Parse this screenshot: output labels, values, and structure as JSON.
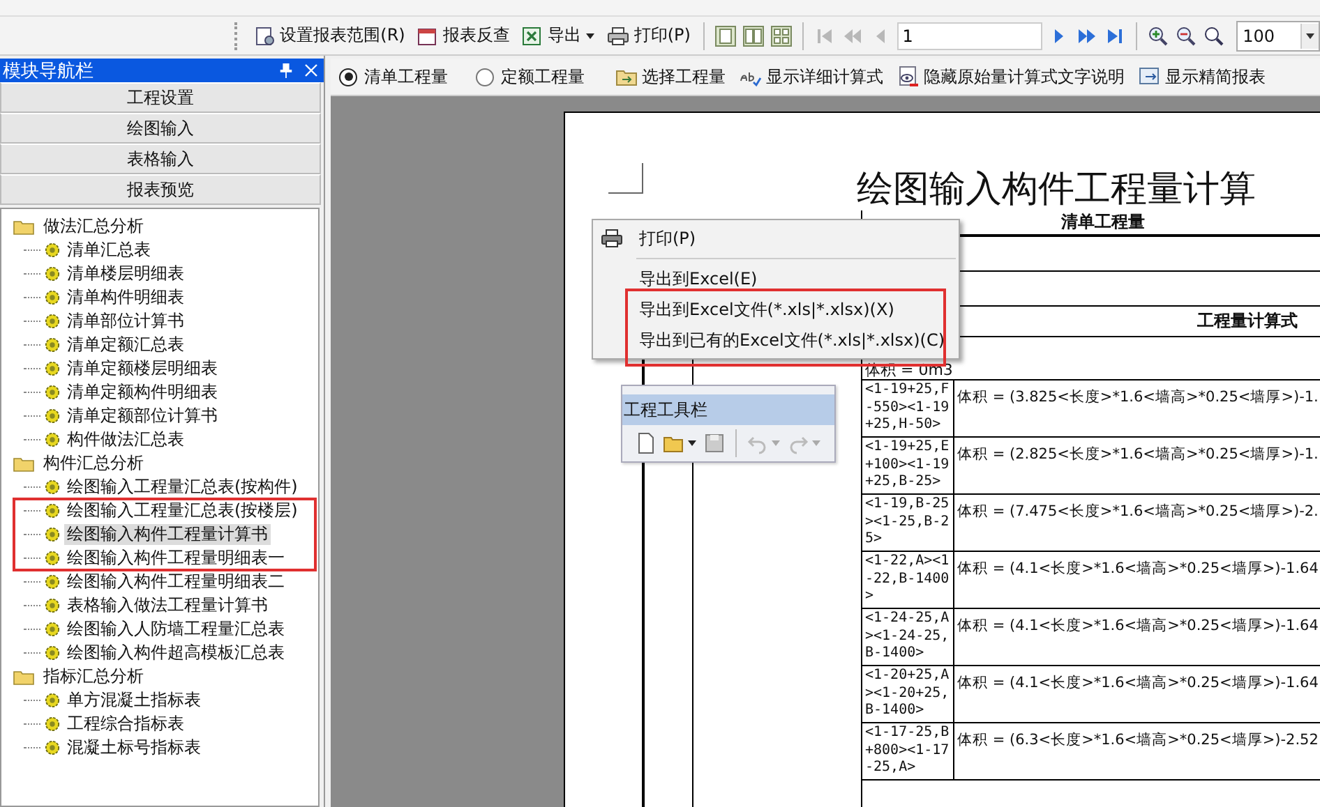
{
  "toolbar": {
    "buttons": [
      {
        "label": "设置报表范围(R)",
        "dropdown": false
      },
      {
        "label": "报表反查",
        "dropdown": false
      },
      {
        "label": "导出",
        "dropdown": true
      },
      {
        "label": "打印(P)",
        "dropdown": false
      }
    ],
    "nav_buttons": [
      {
        "disabled": true
      },
      {
        "disabled": true
      },
      {
        "disabled": true
      },
      {
        "disabled": false
      },
      {
        "disabled": false
      },
      {
        "disabled": false
      }
    ],
    "page": "1",
    "zoom": "100"
  },
  "navigator": {
    "title": "模块导航栏",
    "sections": [
      {
        "label": "工程设置"
      },
      {
        "label": "绘图输入"
      },
      {
        "label": "表格输入"
      },
      {
        "label": "报表预览"
      }
    ],
    "tree": [
      {
        "label": "做法汇总分析",
        "children": [
          {
            "label": "清单汇总表",
            "selected": false
          },
          {
            "label": "清单楼层明细表",
            "selected": false
          },
          {
            "label": "清单构件明细表",
            "selected": false
          },
          {
            "label": "清单部位计算书",
            "selected": false
          },
          {
            "label": "清单定额汇总表",
            "selected": false
          },
          {
            "label": "清单定额楼层明细表",
            "selected": false
          },
          {
            "label": "清单定额构件明细表",
            "selected": false
          },
          {
            "label": "清单定额部位计算书",
            "selected": false
          },
          {
            "label": "构件做法汇总表",
            "selected": false
          }
        ]
      },
      {
        "label": "构件汇总分析",
        "children": [
          {
            "label": "绘图输入工程量汇总表(按构件)",
            "selected": false
          },
          {
            "label": "绘图输入工程量汇总表(按楼层)",
            "selected": false
          },
          {
            "label": "绘图输入构件工程量计算书",
            "selected": true
          },
          {
            "label": "绘图输入构件工程量明细表一",
            "selected": false
          },
          {
            "label": "绘图输入构件工程量明细表二",
            "selected": false
          },
          {
            "label": "表格输入做法工程量计算书",
            "selected": false
          },
          {
            "label": "绘图输入人防墙工程量汇总表",
            "selected": false
          },
          {
            "label": "绘图输入构件超高模板汇总表",
            "selected": false
          }
        ]
      },
      {
        "label": "指标汇总分析",
        "children": [
          {
            "label": "单方混凝土指标表",
            "selected": false
          },
          {
            "label": "工程综合指标表",
            "selected": false
          },
          {
            "label": "混凝土标号指标表",
            "selected": false
          }
        ]
      }
    ]
  },
  "options": {
    "radios": [
      {
        "label": "清单工程量",
        "selected": true
      },
      {
        "label": "定额工程量",
        "selected": false
      }
    ],
    "actions": [
      {
        "label": "选择工程量"
      },
      {
        "label": "显示详细计算式"
      },
      {
        "label": "隐藏原始量计算式文字说明"
      },
      {
        "label": "显示精简报表"
      }
    ]
  },
  "report": {
    "title": "绘图输入构件工程量计算",
    "header": "清单工程量",
    "formula_header": "工程量计算式",
    "first_line": "体积 = 0m3",
    "rows": [
      {
        "position": "<1-19+25,F-550><1-19+25,H-50>",
        "formula": "体积 = (3.825<长度>*1.6<墙高>*0.25<墙厚>)-1."
      },
      {
        "position": "<1-19+25,E+100><1-19+25,B-25>",
        "formula": "体积 = (2.825<长度>*1.6<墙高>*0.25<墙厚>)-1."
      },
      {
        "position": "<1-19,B-25><1-25,B-25>",
        "formula": "体积 = (7.475<长度>*1.6<墙高>*0.25<墙厚>)-2."
      },
      {
        "position": "<1-22,A><1-22,B-1400>",
        "formula": "体积 = (4.1<长度>*1.6<墙高>*0.25<墙厚>)-1.64"
      },
      {
        "position": "<1-24-25,A><1-24-25,B-1400>",
        "formula": "体积 = (4.1<长度>*1.6<墙高>*0.25<墙厚>)-1.64"
      },
      {
        "position": "<1-20+25,A><1-20+25,B-1400>",
        "formula": "体积 = (4.1<长度>*1.6<墙高>*0.25<墙厚>)-1.64"
      },
      {
        "position": "<1-17-25,B+800><1-17-25,A>",
        "formula": "体积 = (6.3<长度>*1.6<墙高>*0.25<墙厚>)-2.52"
      }
    ]
  },
  "context_menu": {
    "items": [
      {
        "kind": "item",
        "label": "打印(P)"
      },
      {
        "kind": "separator"
      },
      {
        "kind": "item",
        "label": "导出到Excel(E)"
      },
      {
        "kind": "item",
        "label": "导出到Excel文件(*.xls|*.xlsx)(X)"
      },
      {
        "kind": "item",
        "label": "导出到已有的Excel文件(*.xls|*.xlsx)(C)"
      }
    ]
  },
  "floating_toolbar": {
    "title": "工程工具栏",
    "tools": [
      {
        "disabled": false,
        "dropdown": false
      },
      {
        "disabled": false,
        "dropdown": true
      },
      {
        "disabled": true,
        "dropdown": false
      },
      {
        "disabled": true,
        "dropdown": true
      },
      {
        "disabled": true,
        "dropdown": true
      }
    ]
  }
}
